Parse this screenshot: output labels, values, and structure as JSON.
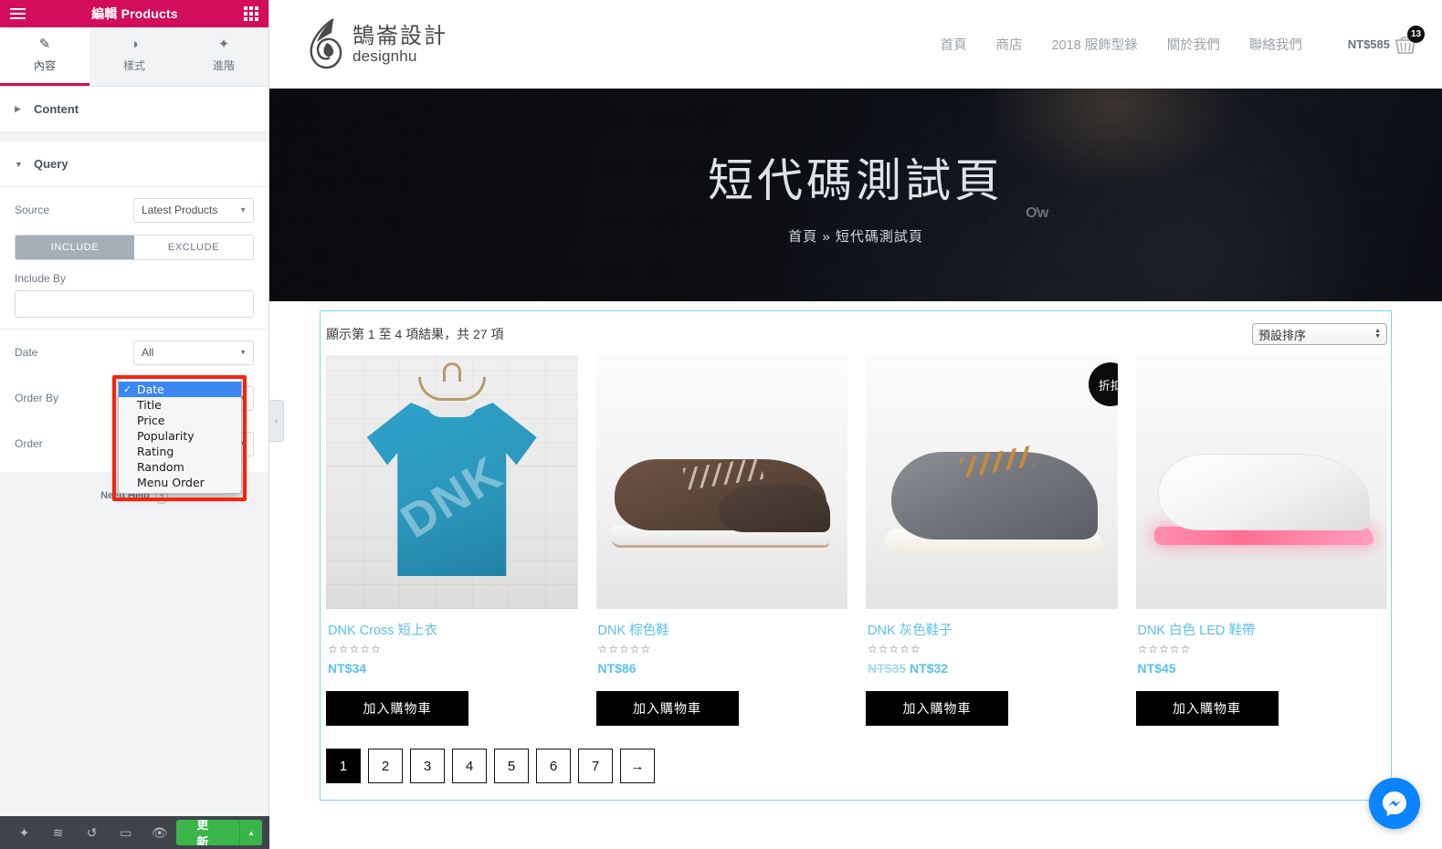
{
  "panel": {
    "title": "編輯 Products",
    "menu_icon": "hamburger-icon",
    "grid_icon": "grid-icon",
    "tabs": [
      {
        "label": "內容",
        "icon": "pencil-icon",
        "active": true
      },
      {
        "label": "樣式",
        "icon": "contrast-icon",
        "active": false
      },
      {
        "label": "進階",
        "icon": "gear-icon",
        "active": false
      }
    ],
    "sections": [
      {
        "label": "Content",
        "expanded": false
      },
      {
        "label": "Query",
        "expanded": true
      }
    ],
    "controls": {
      "source_label": "Source",
      "source_value": "Latest Products",
      "include_tab": "INCLUDE",
      "exclude_tab": "EXCLUDE",
      "include_by_label": "Include By",
      "include_by_value": "",
      "date_label": "Date",
      "date_value": "All",
      "order_by_label": "Order By",
      "order_label": "Order"
    },
    "dropdown": {
      "options": [
        {
          "label": "Date",
          "selected": true
        },
        {
          "label": "Title",
          "selected": false
        },
        {
          "label": "Price",
          "selected": false
        },
        {
          "label": "Popularity",
          "selected": false
        },
        {
          "label": "Rating",
          "selected": false
        },
        {
          "label": "Random",
          "selected": false
        },
        {
          "label": "Menu Order",
          "selected": false
        }
      ],
      "highlight_color": "#f5240b"
    },
    "need_help": "Need Help",
    "footer": {
      "icons": [
        "gear-icon",
        "layers-icon",
        "history-icon",
        "responsive-icon",
        "preview-eye-icon"
      ],
      "update_label": "更新"
    },
    "collapse_handle_icon": "chevron-left-icon",
    "accent_color": "#d30c5c"
  },
  "site": {
    "logo_cn": "鵠崙設計",
    "logo_en": "designhu",
    "nav": [
      "首頁",
      "商店",
      "2018 服飾型錄",
      "關於我們",
      "聯絡我們"
    ],
    "cart_amount": "NT$585",
    "cart_count": "13",
    "hero_title": "短代碼測試頁",
    "hero_breadcrumb": "首頁 » 短代碼測試頁"
  },
  "shop": {
    "result_count": "顯示第 1 至 4 項結果，共 27 項",
    "orderby_value": "預設排序",
    "stars": "☆☆☆☆☆",
    "add_to_cart_label": "加入購物車",
    "sale_badge": "折扣!",
    "products": [
      {
        "title": "DNK Cross 短上衣",
        "price": "NT$34",
        "old_price": "",
        "on_sale": false,
        "watermark": "DNK"
      },
      {
        "title": "DNK 棕色鞋",
        "price": "NT$86",
        "old_price": "",
        "on_sale": false,
        "watermark": ""
      },
      {
        "title": "DNK 灰色鞋子",
        "price": "NT$32",
        "old_price": "NT$35",
        "on_sale": true,
        "watermark": ""
      },
      {
        "title": "DNK 白色 LED 鞋帶",
        "price": "NT$45",
        "old_price": "",
        "on_sale": false,
        "watermark": ""
      }
    ],
    "pagination": [
      "1",
      "2",
      "3",
      "4",
      "5",
      "6",
      "7",
      "→"
    ],
    "current_page": "1",
    "link_color": "#5bc0eb"
  },
  "chat": {
    "icon": "messenger-icon",
    "color": "#0a84ff"
  }
}
